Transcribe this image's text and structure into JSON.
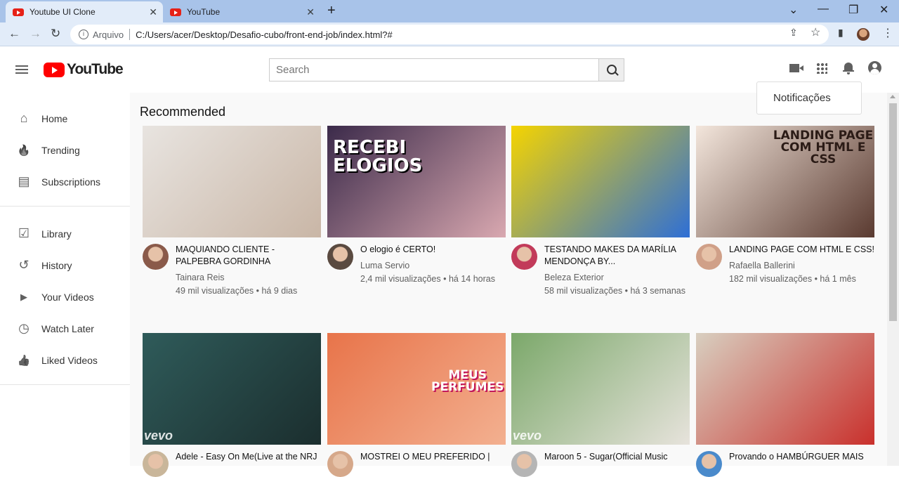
{
  "browser": {
    "tabs": [
      {
        "title": "Youtube UI Clone",
        "close": "✕"
      },
      {
        "title": "YouTube",
        "close": "✕"
      }
    ],
    "new_tab": "+",
    "window_controls": {
      "collapse": "⌄",
      "minimize": "—",
      "restore": "❐",
      "close": "✕"
    },
    "nav": {
      "back": "←",
      "forward": "→",
      "reload": "↻"
    },
    "address": {
      "scheme_label": "Arquivo",
      "url": "C:/Users/acer/Desktop/Desafio-cubo/front-end-job/index.html?#"
    },
    "icons": {
      "share": "⇪",
      "bookmark": "☆",
      "sidepanel": "▮",
      "menu": "⋮"
    }
  },
  "header": {
    "logo_text": "YouTube",
    "search_placeholder": "Search",
    "notifications_popup": "Notificações"
  },
  "sidebar": {
    "groups": [
      [
        {
          "label": "Home",
          "icon": "home-icon",
          "glyph": "⌂"
        },
        {
          "label": "Trending",
          "icon": "trending-icon",
          "glyph": "🔥"
        },
        {
          "label": "Subscriptions",
          "icon": "subscriptions-icon",
          "glyph": "▤"
        }
      ],
      [
        {
          "label": "Library",
          "icon": "library-icon",
          "glyph": "☑"
        },
        {
          "label": "History",
          "icon": "history-icon",
          "glyph": "↺"
        },
        {
          "label": "Your Videos",
          "icon": "your-videos-icon",
          "glyph": "▶"
        },
        {
          "label": "Watch Later",
          "icon": "watch-later-icon",
          "glyph": "◷"
        },
        {
          "label": "Liked Videos",
          "icon": "liked-videos-icon",
          "glyph": "👍"
        }
      ]
    ]
  },
  "main": {
    "section_title": "Recommended",
    "videos": [
      {
        "title": "MAQUIANDO CLIENTE - PALPEBRA GORDINHA",
        "channel": "Tainara Reis",
        "stats": "49 mil visualizações • há 9 dias",
        "thumb_colors": [
          "#e8e4e0",
          "#c9b6a6"
        ],
        "avatar_color": "#8a5a4a"
      },
      {
        "title": "O elogio é CERTO!",
        "channel": "Luma Servio",
        "stats": "2,4 mil visualizações • há 14 horas",
        "overlay": "RECEBI\nELOGIOS",
        "thumb_colors": [
          "#3b2a4a",
          "#d9a8b0"
        ],
        "avatar_color": "#5a4a40"
      },
      {
        "title": "TESTANDO MAKES DA MARÍLIA MENDONÇA BY...",
        "channel": "Beleza Exterior",
        "stats": "58 mil visualizações • há 3 semanas",
        "thumb_colors": [
          "#f5d400",
          "#2e6fd6"
        ],
        "avatar_color": "#c23b5a"
      },
      {
        "title": "LANDING PAGE COM HTML E CSS!",
        "channel": "Rafaella Ballerini",
        "stats": "182 mil visualizações • há 1 mês",
        "overlay_dark": "LANDING PAGE\nCOM HTML E CSS",
        "thumb_colors": [
          "#f3e6dc",
          "#5a3a30"
        ],
        "avatar_color": "#d0a088"
      },
      {
        "title": "Adele - Easy On Me(Live at the NRJ",
        "channel": "",
        "stats": "",
        "vevo": "vevo",
        "thumb_colors": [
          "#2f5b5a",
          "#1b2e2e"
        ],
        "avatar_color": "#c9b69a"
      },
      {
        "title": "MOSTREI O MEU PREFERIDO |",
        "channel": "",
        "stats": "",
        "overlay_red": "MEUS\nPERFUMES",
        "thumb_colors": [
          "#e8744a",
          "#f3b090"
        ],
        "avatar_color": "#d6a88a"
      },
      {
        "title": "Maroon 5 - Sugar(Official Music",
        "channel": "",
        "stats": "",
        "vevo": "vevo",
        "thumb_colors": [
          "#7ba86a",
          "#e7e3dc"
        ],
        "avatar_color": "#b5b5b5"
      },
      {
        "title": "Provando o HAMBÚRGUER MAIS",
        "channel": "",
        "stats": "",
        "thumb_colors": [
          "#d8cfc0",
          "#c9302c"
        ],
        "avatar_color": "#4a8acb"
      }
    ]
  }
}
